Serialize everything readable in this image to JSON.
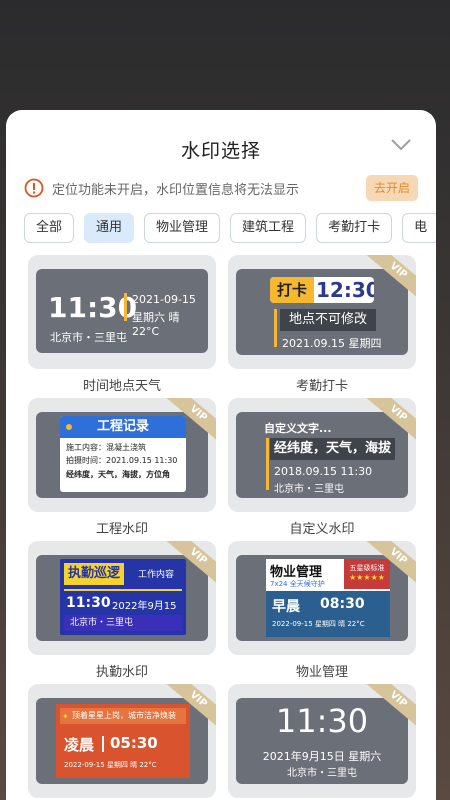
{
  "sheet": {
    "title": "水印选择",
    "notice": "定位功能未开启，水印位置信息将无法显示",
    "open_button": "去开启"
  },
  "tabs": [
    {
      "label": "全部",
      "active": false
    },
    {
      "label": "通用",
      "active": true
    },
    {
      "label": "物业管理",
      "active": false
    },
    {
      "label": "建筑工程",
      "active": false
    },
    {
      "label": "考勤打卡",
      "active": false
    },
    {
      "label": "电",
      "active": false
    }
  ],
  "vip_badge": "VIP",
  "templates": {
    "t1": {
      "label": "时间地点天气",
      "time": "11:30",
      "date": "2021-09-15",
      "weather": "星期六 晴 22°C",
      "location": "北京市・三里屯"
    },
    "t2": {
      "label": "考勤打卡",
      "tag": "打卡",
      "time": "12:30",
      "note": "地点不可修改",
      "date": "2021.09.15 星期四"
    },
    "t3": {
      "label": "工程水印",
      "title": "工程记录",
      "line1": "施工内容：混凝土浇筑",
      "line2": "拍摄时间：2021.09.15 11:30",
      "line3": "经纬度，天气，海拔，方位角"
    },
    "t4": {
      "label": "自定义水印",
      "custom": "自定义文字...",
      "highlight": "经纬度，天气，海拔",
      "datetime": "2018.09.15 11:30",
      "location": "北京市・三里屯"
    },
    "t5": {
      "label": "执勤水印",
      "title": "执勤巡逻",
      "content": "工作内容",
      "time": "11:30",
      "date": "2022年9月15日",
      "location": "北京市・三里屯"
    },
    "t6": {
      "label": "物业管理",
      "title": "物业管理",
      "badge": "五星级标准",
      "stars": "★★★★★",
      "sub": "7x24",
      "sub2": "全天候守护",
      "period": "早晨",
      "time": "08:30",
      "footer": "2022-09-15 星期四 晴 22°C"
    },
    "t7": {
      "label": "",
      "banner": "顶着星星上岗，城市洁净焕装",
      "period": "凌晨",
      "time": "05:30",
      "footer": "2022-09-15 星期四 晴 22°C"
    },
    "t8": {
      "label": "",
      "time": "11:30",
      "date": "2021年9月15日 星期六",
      "location": "北京市・三里屯"
    }
  }
}
